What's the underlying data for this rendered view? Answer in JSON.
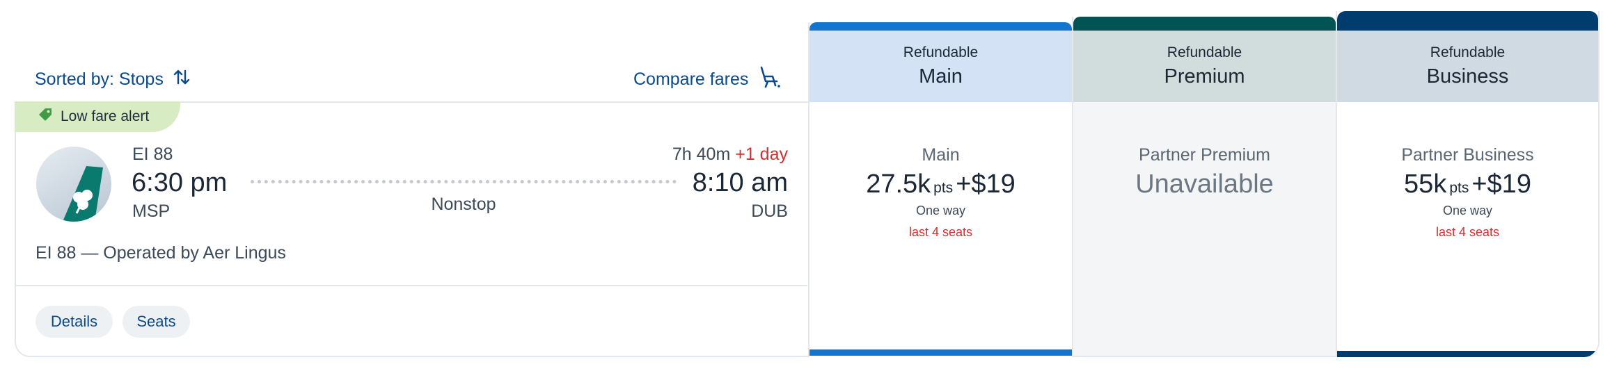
{
  "sort": {
    "label": "Sorted by: Stops",
    "icon": "sort-arrows-icon"
  },
  "compare": {
    "label": "Compare fares",
    "icon": "seat-icon"
  },
  "alert": {
    "label": "Low fare alert",
    "icon": "price-tag-icon"
  },
  "flight": {
    "number": "EI 88",
    "depart_time": "6:30 pm",
    "depart_airport": "MSP",
    "duration": "7h 40m",
    "day_offset": "+1 day",
    "arrive_time": "8:10 am",
    "arrive_airport": "DUB",
    "stops": "Nonstop",
    "operated_by": "EI 88 — Operated by Aer Lingus",
    "airline_logo": "shamrock-tail-logo"
  },
  "actions": {
    "details": "Details",
    "seats": "Seats"
  },
  "fares": [
    {
      "header_sub": "Refundable",
      "header_name": "Main",
      "label": "Main",
      "price_pts": "27.5k",
      "pts_unit": "pts",
      "plus": "+",
      "price_cash": "$19",
      "oneway": "One way",
      "seats": "last 4 seats",
      "accent": "#1275d0",
      "head_bg": "#d3e3f5"
    },
    {
      "header_sub": "Refundable",
      "header_name": "Premium",
      "label": "Partner Premium",
      "unavailable": "Unavailable",
      "accent": "#025454",
      "head_bg": "#d1dcdc",
      "body_bg": "#f4f5f6"
    },
    {
      "header_sub": "Refundable",
      "header_name": "Business",
      "label": "Partner Business",
      "price_pts": "55k",
      "pts_unit": "pts",
      "plus": "+",
      "price_cash": "$19",
      "oneway": "One way",
      "seats": "last 4 seats",
      "accent": "#003c6e",
      "head_bg": "#d0dae3"
    }
  ],
  "colors": {
    "link": "#0b4a8c",
    "alert_bg": "#d8ecc4",
    "warning": "#d0302f"
  }
}
